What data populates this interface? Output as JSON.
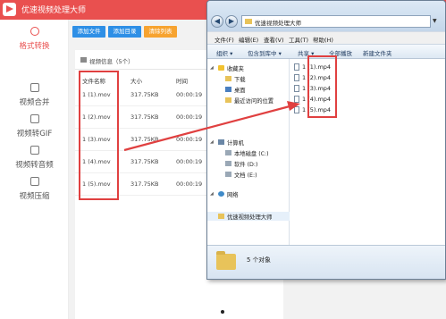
{
  "app": {
    "title": "优速视频处理大师",
    "toolbar": {
      "add_file": "添加文件",
      "add_folder": "添加目录",
      "clear_list": "清除列表"
    },
    "sidebar": [
      {
        "label": "格式转换",
        "active": true
      },
      {
        "label": "视频合并",
        "active": false
      },
      {
        "label": "视频转GIF",
        "active": false
      },
      {
        "label": "视频转音频",
        "active": false
      },
      {
        "label": "视频压缩",
        "active": false
      }
    ],
    "panel_title": "视频信息（5个）",
    "columns": {
      "name": "文件名称",
      "size": "大小",
      "time": "时间"
    },
    "rows": [
      {
        "name": "1 (1).mov",
        "size": "317.75KB",
        "time": "00:00:19"
      },
      {
        "name": "1 (2).mov",
        "size": "317.75KB",
        "time": "00:00:19"
      },
      {
        "name": "1 (3).mov",
        "size": "317.75KB",
        "time": "00:00:19"
      },
      {
        "name": "1 (4).mov",
        "size": "317.75KB",
        "time": "00:00:19"
      },
      {
        "name": "1 (5).mov",
        "size": "317.75KB",
        "time": "00:00:19"
      }
    ]
  },
  "explorer": {
    "address": "优速视频处理大师",
    "menu": [
      "文件(F)",
      "编辑(E)",
      "查看(V)",
      "工具(T)",
      "帮助(H)"
    ],
    "commands": [
      "组织 ▾",
      "包含到库中 ▾",
      "共享 ▾",
      "全部播放",
      "新建文件夹"
    ],
    "nav": {
      "favorites": "收藏夹",
      "downloads": "下载",
      "desktop": "桌面",
      "recent": "最近访问的位置",
      "computer": "计算机",
      "drive_c": "本地磁盘 (C:)",
      "drive_d": "软件 (D:)",
      "drive_e": "文档 (E:)",
      "network": "网络",
      "current_folder": "优速视频处理大师"
    },
    "files": [
      "1 (1).mp4",
      "1 (2).mp4",
      "1 (3).mp4",
      "1 (4).mp4",
      "1 (5).mp4"
    ],
    "status": "5 个对象"
  },
  "colors": {
    "brand_red": "#e9504f",
    "toolbar_blue": "#2e8fe6",
    "toolbar_orange": "#f7a330",
    "annotation_red": "#e04040"
  }
}
